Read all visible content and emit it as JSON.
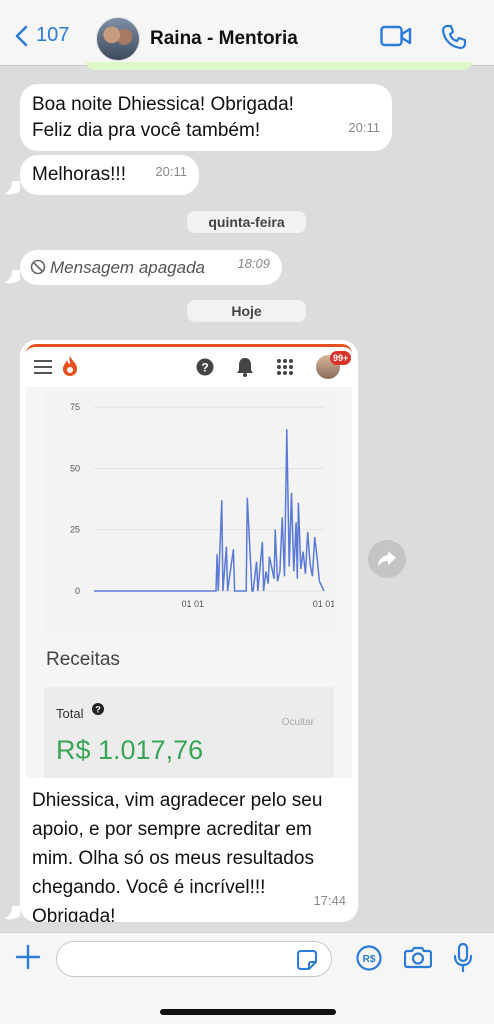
{
  "header": {
    "back_count": "107",
    "contact_name": "Raina - Mentoria"
  },
  "messages": [
    {
      "text_lines": [
        "Boa noite Dhiessica! Obrigada!",
        "Feliz dia pra você também!"
      ],
      "time": "20:11"
    },
    {
      "text": "Melhoras!!!",
      "time": "20:11"
    },
    {
      "date_separator": "quinta-feira"
    },
    {
      "deleted_text": "Mensagem apagada",
      "time": "18:09"
    },
    {
      "date_separator": "Hoje"
    },
    {
      "image_message": {
        "badge": "99+",
        "chart_data": {
          "type": "line",
          "title": "",
          "xlabel": "",
          "ylabel": "",
          "ylim": [
            0,
            75
          ],
          "yticks": [
            "75",
            "50",
            "25",
            "0"
          ],
          "xticks": [
            "01 01",
            "01 01"
          ],
          "x": [
            0,
            50,
            100,
            105,
            106,
            107,
            110,
            111,
            114,
            115,
            120,
            121,
            131,
            132,
            136,
            137,
            140,
            141,
            145,
            146,
            148,
            150,
            151,
            155,
            156,
            158,
            160,
            162,
            164,
            166,
            168,
            170,
            172,
            174,
            175,
            176,
            178,
            180,
            182,
            184,
            186,
            188,
            190,
            192,
            194,
            196,
            198
          ],
          "y": [
            0,
            0,
            0,
            0,
            15,
            0,
            37,
            0,
            18,
            0,
            17,
            0,
            0,
            38,
            0,
            0,
            12,
            0,
            20,
            0,
            8,
            3,
            14,
            5,
            25,
            4,
            8,
            30,
            6,
            66,
            10,
            40,
            8,
            28,
            5,
            36,
            9,
            16,
            7,
            24,
            11,
            6,
            22,
            14,
            4,
            2,
            0
          ],
          "series_color": "#5b7ad6"
        },
        "section_title": "Receitas",
        "total_label": "Total",
        "hide_label": "Ocultar",
        "total_value": "R$ 1.017,76"
      },
      "caption_lines": [
        "Dhiessica, vim  agradecer pelo seu",
        "apoio, e por sempre acreditar em",
        "mim. Olha só os meus resultados",
        "chegando. Você é incrível!!!",
        "Obrigada!"
      ],
      "time": "17:44"
    }
  ],
  "composer": {
    "placeholder": ""
  }
}
